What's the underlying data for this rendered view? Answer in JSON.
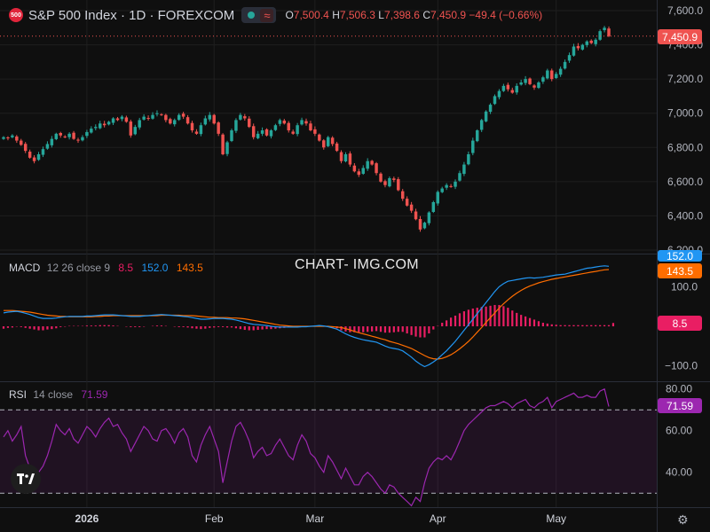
{
  "header": {
    "symbol_badge": "500",
    "title": "S&P 500 Index · 1D · FOREXCOM",
    "wave_icon": "≈",
    "ohlc": [
      {
        "k": "O",
        "v": "7,500.4"
      },
      {
        "k": "H",
        "v": "7,506.3"
      },
      {
        "k": "L",
        "v": "7,398.6"
      },
      {
        "k": "C",
        "v": "7,450.9"
      },
      {
        "k": "",
        "v": "−49.4 (−0.66%)"
      }
    ]
  },
  "watermark": "CHART- IMG.COM",
  "colors": {
    "up": "#26a69a",
    "down": "#ef5350",
    "macd": "#2196f3",
    "signal": "#ff6d00",
    "hist": "#e91e63",
    "rsi": "#9c27b0",
    "background": "#0f0f0f",
    "grid": "#1f1f1f"
  },
  "chart_data": [
    {
      "type": "candlestick",
      "pane": "price",
      "ylim": [
        6200,
        7600
      ],
      "y_ticks": [
        "7,600.0",
        "7,400.0",
        "7,200.0",
        "7,000.0",
        "6,800.0",
        "6,600.0",
        "6,400.0",
        "6,200.0"
      ],
      "y_tick_values": [
        7600,
        7400,
        7200,
        7000,
        6800,
        6600,
        6400,
        6200
      ],
      "last_price_label": "7,450.9",
      "last_price": 7450.9,
      "x_ticks": [
        {
          "label": "2026",
          "index": 19,
          "bold": true
        },
        {
          "label": "Feb",
          "index": 48
        },
        {
          "label": "Mar",
          "index": 71
        },
        {
          "label": "Apr",
          "index": 99
        },
        {
          "label": "May",
          "index": 126
        }
      ],
      "closes": [
        6860,
        6855,
        6870,
        6840,
        6815,
        6780,
        6740,
        6720,
        6760,
        6790,
        6820,
        6850,
        6880,
        6870,
        6860,
        6880,
        6850,
        6840,
        6860,
        6890,
        6910,
        6920,
        6940,
        6930,
        6950,
        6970,
        6960,
        6980,
        6950,
        6870,
        6920,
        6960,
        6980,
        6970,
        6990,
        7000,
        6990,
        6960,
        6940,
        6960,
        6990,
        6980,
        6940,
        6900,
        6880,
        6930,
        6970,
        6990,
        6940,
        6880,
        6760,
        6830,
        6900,
        6960,
        6990,
        6970,
        6920,
        6860,
        6880,
        6900,
        6870,
        6900,
        6930,
        6960,
        6940,
        6900,
        6880,
        6930,
        6960,
        6940,
        6900,
        6880,
        6840,
        6800,
        6860,
        6820,
        6780,
        6720,
        6760,
        6700,
        6660,
        6640,
        6680,
        6720,
        6700,
        6650,
        6600,
        6580,
        6620,
        6610,
        6550,
        6500,
        6460,
        6430,
        6380,
        6320,
        6360,
        6420,
        6480,
        6540,
        6560,
        6580,
        6570,
        6600,
        6650,
        6700,
        6760,
        6840,
        6900,
        6960,
        7010,
        7050,
        7100,
        7130,
        7160,
        7140,
        7120,
        7160,
        7180,
        7200,
        7170,
        7150,
        7180,
        7210,
        7250,
        7200,
        7230,
        7260,
        7300,
        7340,
        7390,
        7380,
        7400,
        7420,
        7410,
        7430,
        7480,
        7500,
        7450.9
      ]
    },
    {
      "type": "line",
      "pane": "macd",
      "indicator_label": "MACD",
      "params": "12 26 close 9",
      "legend_values": [
        "8.5",
        "152.0",
        "143.5"
      ],
      "ylim": [
        -130,
        175
      ],
      "y_ticks": [
        "100.0",
        "−100.0"
      ],
      "y_tick_values": [
        100,
        -100
      ],
      "series": [
        {
          "name": "MACD",
          "values": [
            34,
            36,
            37,
            38,
            36,
            33,
            30,
            26,
            22,
            20,
            20,
            20,
            21,
            23,
            24,
            25,
            25,
            25,
            25,
            26,
            26,
            27,
            28,
            29,
            29,
            29,
            28,
            27,
            26,
            25,
            25,
            25,
            26,
            27,
            28,
            29,
            30,
            29,
            28,
            27,
            26,
            25,
            24,
            22,
            20,
            18,
            18,
            19,
            20,
            20,
            20,
            19,
            18,
            16,
            13,
            10,
            7,
            5,
            4,
            3,
            2,
            0,
            -1,
            -2,
            -2,
            -2,
            -2,
            -2,
            -1,
            -1,
            0,
            1,
            2,
            1,
            -1,
            -4,
            -7,
            -13,
            -19,
            -24,
            -28,
            -31,
            -34,
            -36,
            -38,
            -40,
            -45,
            -50,
            -54,
            -56,
            -58,
            -62,
            -70,
            -78,
            -88,
            -96,
            -102,
            -97,
            -90,
            -82,
            -72,
            -62,
            -50,
            -38,
            -24,
            -10,
            4,
            18,
            32,
            46,
            60,
            74,
            88,
            100,
            108,
            114,
            116,
            118,
            120,
            122,
            123,
            122,
            123,
            124,
            126,
            128,
            130,
            131,
            132,
            135,
            138,
            141,
            144,
            147,
            148,
            150,
            152,
            153,
            152
          ]
        },
        {
          "name": "Signal",
          "values": [
            40,
            40,
            40,
            39,
            38,
            37,
            36,
            34,
            32,
            30,
            28,
            27,
            26,
            25,
            25,
            24,
            24,
            24,
            24,
            24,
            24,
            25,
            25,
            26,
            26,
            27,
            27,
            27,
            27,
            27,
            27,
            27,
            27,
            27,
            27,
            27,
            28,
            28,
            28,
            28,
            28,
            27,
            27,
            27,
            26,
            25,
            24,
            23,
            23,
            22,
            22,
            22,
            21,
            21,
            20,
            19,
            17,
            15,
            13,
            11,
            9,
            7,
            5,
            3,
            2,
            1,
            0,
            0,
            0,
            0,
            0,
            0,
            0,
            0,
            0,
            -1,
            -2,
            -3,
            -6,
            -9,
            -13,
            -16,
            -19,
            -22,
            -25,
            -28,
            -31,
            -34,
            -38,
            -41,
            -44,
            -48,
            -52,
            -56,
            -62,
            -68,
            -74,
            -79,
            -82,
            -83,
            -81,
            -77,
            -72,
            -65,
            -57,
            -48,
            -38,
            -27,
            -15,
            -3,
            10,
            22,
            34,
            46,
            57,
            67,
            76,
            84,
            91,
            97,
            102,
            106,
            110,
            113,
            116,
            119,
            121,
            123,
            125,
            127,
            129,
            131,
            133,
            135,
            137,
            139,
            141,
            143,
            143.5
          ]
        }
      ]
    },
    {
      "type": "line",
      "pane": "rsi",
      "indicator_label": "RSI",
      "params": "14 close",
      "legend_value": "71.59",
      "ylim": [
        25,
        82
      ],
      "bands": [
        70,
        30
      ],
      "y_ticks": [
        "80.00",
        "60.00",
        "40.00"
      ],
      "y_tick_values": [
        80,
        60,
        40
      ],
      "series": [
        {
          "name": "RSI",
          "values": [
            57,
            60,
            55,
            58,
            62,
            48,
            42,
            38,
            40,
            43,
            48,
            55,
            63,
            60,
            58,
            61,
            56,
            54,
            58,
            62,
            60,
            57,
            61,
            64,
            66,
            62,
            63,
            59,
            56,
            50,
            54,
            58,
            62,
            60,
            56,
            55,
            60,
            61,
            58,
            54,
            59,
            61,
            57,
            48,
            45,
            53,
            58,
            62,
            56,
            50,
            35,
            45,
            55,
            62,
            64,
            60,
            55,
            47,
            50,
            52,
            48,
            49,
            53,
            56,
            52,
            48,
            46,
            53,
            58,
            55,
            49,
            47,
            43,
            40,
            48,
            45,
            41,
            37,
            42,
            38,
            34,
            34,
            38,
            40,
            38,
            35,
            32,
            30,
            34,
            33,
            30,
            28,
            26,
            24,
            28,
            26,
            35,
            42,
            45,
            47,
            46,
            48,
            46,
            50,
            55,
            60,
            63,
            65,
            67,
            69,
            71,
            72,
            72,
            73,
            74,
            73,
            71,
            73,
            74,
            75,
            72,
            71,
            73,
            74,
            76,
            71,
            74,
            75,
            76,
            77,
            78,
            76,
            76,
            77,
            76,
            76,
            79,
            80,
            71.59
          ]
        }
      ]
    },
    {
      "type": "bar",
      "pane": "macd",
      "name": "Histogram",
      "values": [
        -6,
        -4,
        -3,
        -1,
        -2,
        -4,
        -6,
        -8,
        -10,
        -10,
        -8,
        -7,
        -5,
        -2,
        -1,
        1,
        1,
        1,
        1,
        2,
        2,
        2,
        3,
        3,
        3,
        2,
        1,
        0,
        -1,
        -2,
        -2,
        -2,
        -1,
        0,
        1,
        2,
        2,
        1,
        0,
        -1,
        -2,
        -2,
        -3,
        -5,
        -6,
        -7,
        -6,
        -4,
        -3,
        -2,
        -2,
        -3,
        -3,
        -5,
        -7,
        -9,
        -10,
        -10,
        -9,
        -8,
        -7,
        -7,
        -6,
        -5,
        -4,
        -3,
        -2,
        -2,
        -1,
        -1,
        0,
        1,
        2,
        1,
        -1,
        -3,
        -5,
        -10,
        -13,
        -15,
        -15,
        -15,
        -15,
        -14,
        -13,
        -12,
        -14,
        -16,
        -16,
        -15,
        -14,
        -14,
        -18,
        -22,
        -26,
        -28,
        -28,
        -18,
        -8,
        1,
        9,
        15,
        22,
        27,
        33,
        38,
        42,
        45,
        47,
        49,
        50,
        52,
        54,
        54,
        51,
        47,
        40,
        34,
        29,
        25,
        21,
        17,
        13,
        9,
        7,
        5,
        4,
        3,
        3,
        3,
        3,
        3,
        3,
        3,
        3,
        3,
        3,
        3,
        3,
        8.5
      ]
    }
  ]
}
